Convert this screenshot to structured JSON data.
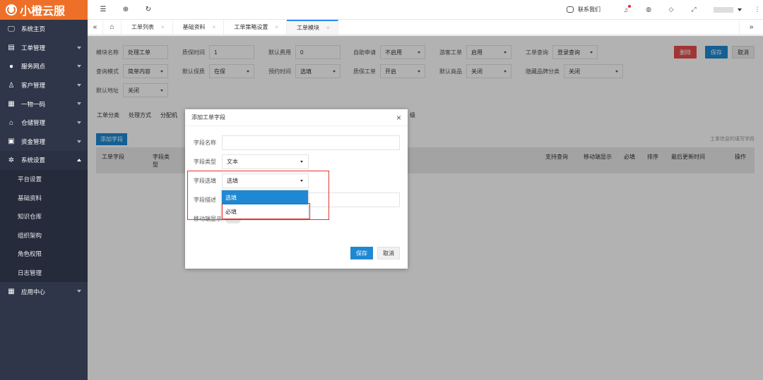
{
  "brand": {
    "logo_text": "小橙云服",
    "accent": "#ee6f27"
  },
  "sidebar": {
    "items": [
      {
        "label": "系统主页",
        "icon": "monitor-icon",
        "has_arrow": false
      },
      {
        "label": "工单管理",
        "icon": "document-icon",
        "has_arrow": true
      },
      {
        "label": "服务网点",
        "icon": "location-icon",
        "has_arrow": true
      },
      {
        "label": "客户管理",
        "icon": "user-icon",
        "has_arrow": true
      },
      {
        "label": "一物一码",
        "icon": "barcode-icon",
        "has_arrow": true
      },
      {
        "label": "仓储管理",
        "icon": "warehouse-icon",
        "has_arrow": true
      },
      {
        "label": "资金管理",
        "icon": "wallet-icon",
        "has_arrow": true
      },
      {
        "label": "系统设置",
        "icon": "gear-icon",
        "has_arrow": true,
        "expanded": true
      }
    ],
    "sub_items": [
      "平台设置",
      "基础资料",
      "知识仓库",
      "组织架构",
      "角色权限",
      "日志管理"
    ],
    "bottom_item": {
      "label": "应用中心",
      "icon": "grid-icon"
    }
  },
  "topbar": {
    "contact_label": "联系我们",
    "icons": [
      "bell-icon",
      "palette-icon",
      "tag-icon",
      "fullscreen-icon"
    ]
  },
  "tabs": [
    {
      "label": "工单列表"
    },
    {
      "label": "基础资料"
    },
    {
      "label": "工单策略设置"
    },
    {
      "label": "工单模块",
      "active": true
    }
  ],
  "form": {
    "module_name_label": "模块名称",
    "module_name_value": "处理工单",
    "warranty_time_label": "质保时间",
    "warranty_time_value": "1",
    "default_fee_label": "默认费用",
    "default_fee_value": "0",
    "auto_apply_label": "自助申请",
    "auto_apply_value": "不启用",
    "visitor_order_label": "游客工单",
    "visitor_order_value": "启用",
    "order_query_label": "工单查询",
    "order_query_value": "登录查询",
    "query_mode_label": "查询模式",
    "query_mode_value": "简单内容",
    "default_warranty_label": "默认保质",
    "default_warranty_value": "在保",
    "booking_time_label": "预约时间",
    "booking_time_value": "选填",
    "warranty_order_label": "质保工单",
    "warranty_order_value": "开启",
    "default_product_label": "默认商品",
    "default_product_value": "关闭",
    "hide_brand_label": "隐藏品牌分类",
    "hide_brand_value": "关闭",
    "default_address_label": "默认地址",
    "default_address_value": "关闭",
    "delete_label": "删除",
    "save_label": "保存",
    "cancel_label": "取消"
  },
  "subtabs": [
    "工单分类",
    "处理方式",
    "分配机",
    "级"
  ],
  "add_field_label": "添加字段",
  "hint_text": "工单信息的填写字段",
  "table_headers": {
    "field": "工单字段",
    "type": "字段类\n型",
    "query": "支持查询",
    "mobile": "移动端显示",
    "required": "必填",
    "sort": "排序",
    "updated": "最后更新时间",
    "action": "操作"
  },
  "modal": {
    "title": "添加工单字段",
    "field_name_label": "字段名称",
    "field_name_value": "",
    "field_type_label": "字段类型",
    "field_type_value": "文本",
    "field_option_label": "字段选填",
    "field_option_value": "选填",
    "field_desc_label": "字段描述",
    "mobile_show_label": "移动端显示",
    "dropdown_options": [
      "选填",
      "必填"
    ],
    "save_label": "保存",
    "cancel_label": "取消"
  },
  "colors": {
    "primary": "#1e88d3",
    "danger": "#e74c4c",
    "highlight": "#e5332e"
  }
}
